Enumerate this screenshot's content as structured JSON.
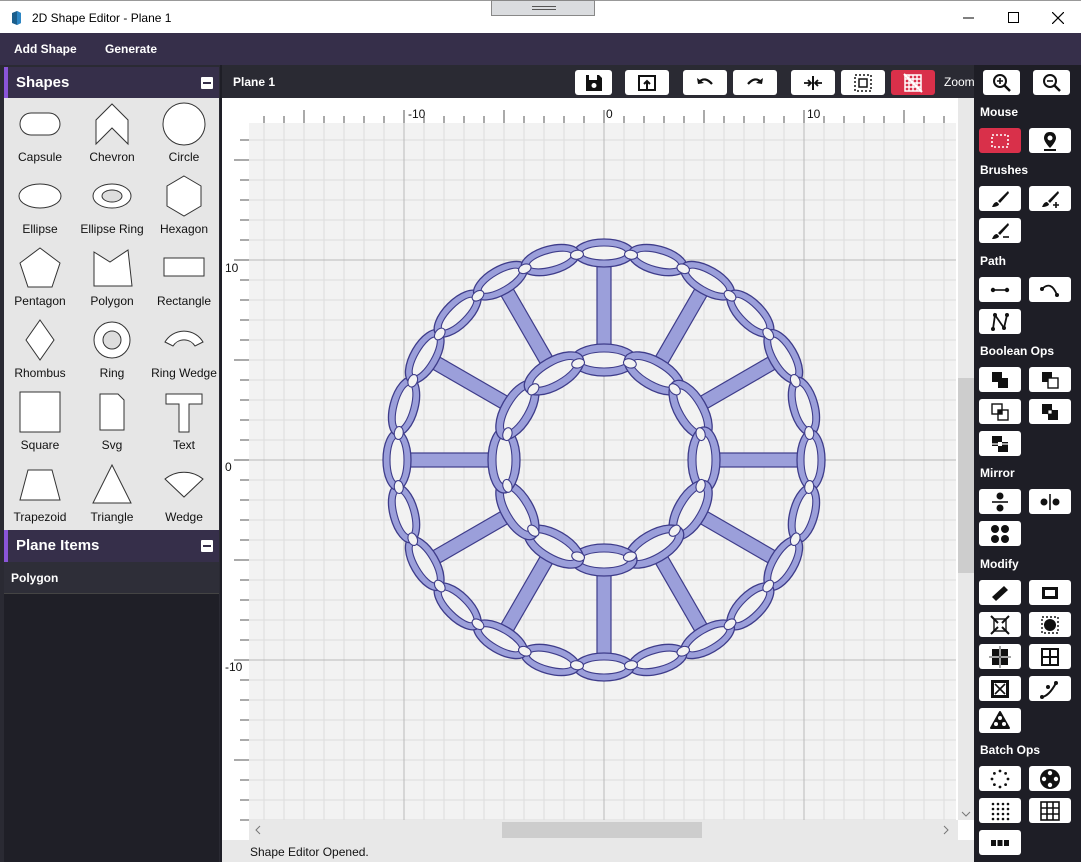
{
  "window": {
    "title": "2D Shape Editor - Plane 1",
    "controls": [
      "minimize",
      "maximize",
      "close"
    ]
  },
  "menu": {
    "items": [
      "Add Shape",
      "Generate"
    ]
  },
  "shapes_panel": {
    "title": "Shapes",
    "items": [
      {
        "label": "Capsule",
        "icon": "capsule-icon"
      },
      {
        "label": "Chevron",
        "icon": "chevron-icon"
      },
      {
        "label": "Circle",
        "icon": "circle-icon"
      },
      {
        "label": "Ellipse",
        "icon": "ellipse-icon"
      },
      {
        "label": "Ellipse Ring",
        "icon": "ellipse-ring-icon"
      },
      {
        "label": "Hexagon",
        "icon": "hexagon-icon"
      },
      {
        "label": "Pentagon",
        "icon": "pentagon-icon"
      },
      {
        "label": "Polygon",
        "icon": "polygon-icon"
      },
      {
        "label": "Rectangle",
        "icon": "rectangle-icon"
      },
      {
        "label": "Rhombus",
        "icon": "rhombus-icon"
      },
      {
        "label": "Ring",
        "icon": "ring-icon"
      },
      {
        "label": "Ring Wedge",
        "icon": "ring-wedge-icon"
      },
      {
        "label": "Square",
        "icon": "square-icon"
      },
      {
        "label": "Svg",
        "icon": "svg-file-icon"
      },
      {
        "label": "Text",
        "icon": "text-icon"
      },
      {
        "label": "Trapezoid",
        "icon": "trapezoid-icon"
      },
      {
        "label": "Triangle",
        "icon": "triangle-icon"
      },
      {
        "label": "Wedge",
        "icon": "wedge-icon"
      }
    ]
  },
  "plane_items_panel": {
    "title": "Plane Items",
    "items": [
      "Polygon"
    ]
  },
  "editor": {
    "tab_title": "Plane 1",
    "zoom_label": "Zoom",
    "toolbar": [
      "save-icon",
      "export-icon",
      "undo-icon",
      "redo-icon",
      "fit-icon",
      "select-all-icon",
      "grid-toggle-icon",
      "zoom-in-icon",
      "zoom-out-icon"
    ],
    "active_tool": "grid-toggle-icon",
    "ruler_h_labels": [
      "-10",
      "0",
      "10"
    ],
    "ruler_v_labels": [
      "10",
      "0",
      "-10"
    ],
    "shape_fill": "#9b9fda",
    "shape_stroke": "#3e3c8a",
    "accent": "#d9304a"
  },
  "status": {
    "text": "Shape Editor Opened."
  },
  "tool_panel": {
    "sections": [
      {
        "label": "Mouse",
        "tools": [
          "rectangle-select-icon",
          "pin-icon"
        ]
      },
      {
        "label": "Brushes",
        "tools": [
          "brush-icon",
          "brush-add-icon",
          "brush-subtract-icon"
        ]
      },
      {
        "label": "Path",
        "tools": [
          "line-path-icon",
          "curve-path-icon",
          "freeform-path-icon"
        ]
      },
      {
        "label": "Boolean Ops",
        "tools": [
          "union-icon",
          "subtract-icon",
          "intersect-icon",
          "exclude-icon",
          "divide-icon"
        ]
      },
      {
        "label": "Mirror",
        "tools": [
          "mirror-vertical-icon",
          "mirror-horizontal-icon",
          "mirror-quad-icon"
        ]
      },
      {
        "label": "Modify",
        "tools": [
          "skew-icon",
          "outline-icon",
          "expand-icon",
          "round-corners-icon",
          "split-icon",
          "grid-split-icon",
          "inset-icon",
          "bend-icon",
          "triangulate-icon"
        ]
      },
      {
        "label": "Batch Ops",
        "tools": [
          "circular-array-icon",
          "circle-pattern-icon",
          "dot-grid-icon",
          "grid-array-icon",
          "linear-array-icon"
        ]
      }
    ],
    "active_tool": "rectangle-select-icon"
  }
}
